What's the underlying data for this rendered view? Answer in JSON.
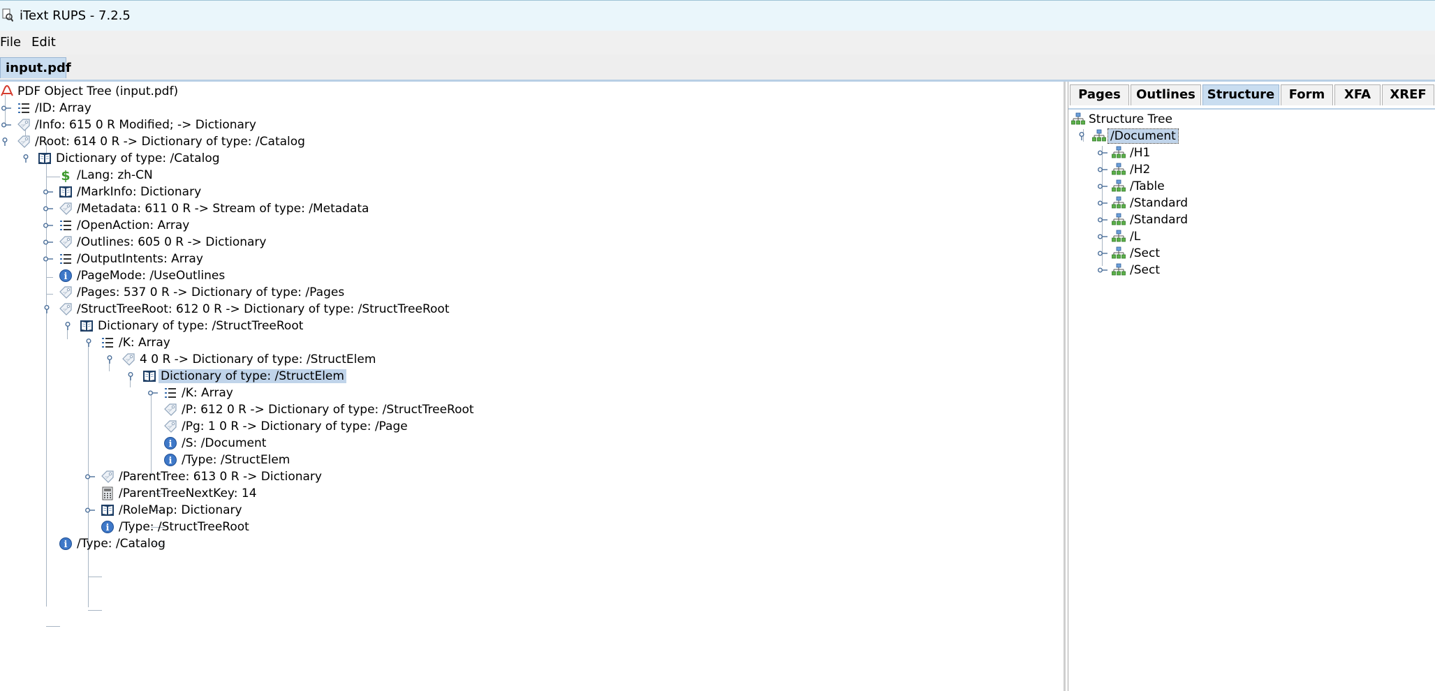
{
  "window": {
    "title": "iText RUPS - 7.2.5"
  },
  "menu": {
    "file": "File",
    "edit": "Edit"
  },
  "doc_tab": {
    "label": "input.pdf"
  },
  "object_tree": {
    "root": "PDF Object Tree (input.pdf)",
    "id": "/ID: Array",
    "info": "/Info: 615 0 R Modified; -> Dictionary",
    "root_ref": "/Root: 614 0 R -> Dictionary of type: /Catalog",
    "catalog": "Dictionary of type: /Catalog",
    "lang": "/Lang: zh-CN",
    "markinfo": "/MarkInfo: Dictionary",
    "metadata": "/Metadata: 611 0 R -> Stream of type: /Metadata",
    "openaction": "/OpenAction: Array",
    "outlines": "/Outlines: 605 0 R -> Dictionary",
    "outputintents": "/OutputIntents: Array",
    "pagemode": "/PageMode: /UseOutlines",
    "pages": "/Pages: 537 0 R -> Dictionary of type: /Pages",
    "structtreeroot": "/StructTreeRoot: 612 0 R -> Dictionary of type: /StructTreeRoot",
    "str_dict": "Dictionary of type: /StructTreeRoot",
    "k_array": "/K: Array",
    "ref_4": "4 0 R -> Dictionary of type: /StructElem",
    "structelem_dict": "Dictionary of type: /StructElem",
    "se_k": "/K: Array",
    "se_p": "/P: 612 0 R -> Dictionary of type: /StructTreeRoot",
    "se_pg": "/Pg: 1 0 R -> Dictionary of type: /Page",
    "se_s": "/S: /Document",
    "se_type": "/Type: /StructElem",
    "parenttree": "/ParentTree: 613 0 R -> Dictionary",
    "parenttreenextkey": "/ParentTreeNextKey: 14",
    "rolemap": "/RoleMap: Dictionary",
    "str_type": "/Type: /StructTreeRoot",
    "catalog_type": "/Type: /Catalog"
  },
  "right_tabs": [
    "Pages",
    "Outlines",
    "Structure",
    "Form",
    "XFA",
    "XREF"
  ],
  "structure_tree": {
    "root": "Structure Tree",
    "document": "/Document",
    "children": [
      "/H1",
      "/H2",
      "/Table",
      "/Standard",
      "/Standard",
      "/L",
      "/Sect",
      "/Sect"
    ]
  },
  "colors": {
    "selection": "#c0d4ea",
    "tab_active": "#c9ddf0",
    "titlebar": "#eaf6fb"
  }
}
